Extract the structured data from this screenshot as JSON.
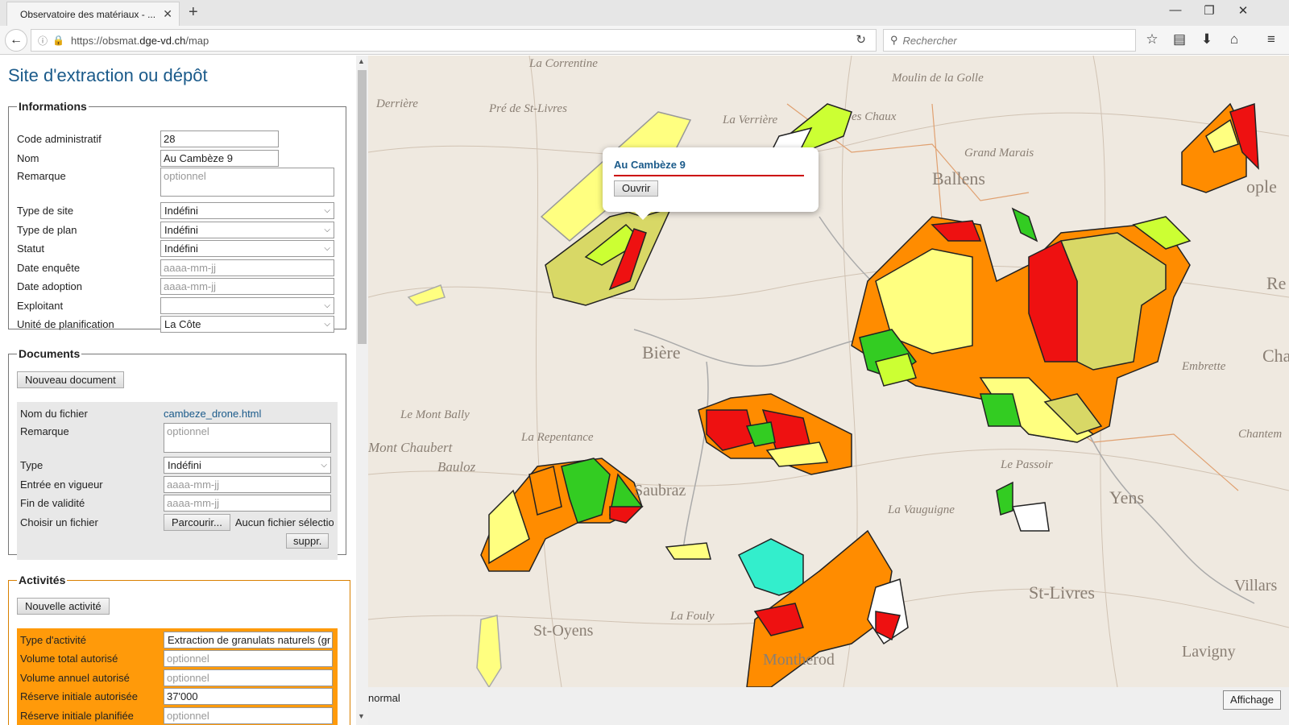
{
  "browser": {
    "tab_title": "Observatoire des matériaux - ...",
    "url_prefix": "https://obsmat.",
    "url_host": "dge-vd.ch",
    "url_path": "/map",
    "search_placeholder": "Rechercher"
  },
  "panel": {
    "title": "Site d'extraction ou dépôt",
    "informations": {
      "legend": "Informations",
      "code_label": "Code administratif",
      "code_value": "28",
      "nom_label": "Nom",
      "nom_value": "Au Cambèze 9",
      "remarque_label": "Remarque",
      "remarque_placeholder": "optionnel",
      "type_site_label": "Type de site",
      "type_site_value": "Indéfini",
      "type_plan_label": "Type de plan",
      "type_plan_value": "Indéfini",
      "statut_label": "Statut",
      "statut_value": "Indéfini",
      "date_enquete_label": "Date enquête",
      "date_enquete_placeholder": "aaaa-mm-jj",
      "date_adoption_label": "Date adoption",
      "date_adoption_placeholder": "aaaa-mm-jj",
      "exploitant_label": "Exploitant",
      "exploitant_value": "",
      "unite_label": "Unité de planification",
      "unite_value": "La Côte"
    },
    "documents": {
      "legend": "Documents",
      "new_button": "Nouveau document",
      "fichier_label": "Nom du fichier",
      "fichier_value": "cambeze_drone.html",
      "remarque_label": "Remarque",
      "remarque_placeholder": "optionnel",
      "type_label": "Type",
      "type_value": "Indéfini",
      "entree_label": "Entrée en vigueur",
      "entree_placeholder": "aaaa-mm-jj",
      "fin_label": "Fin de validité",
      "fin_placeholder": "aaaa-mm-jj",
      "choisir_label": "Choisir un fichier",
      "parcourir": "Parcourir...",
      "aucun": "Aucun fichier sélection",
      "suppr": "suppr."
    },
    "activites": {
      "legend": "Activités",
      "new_button": "Nouvelle activité",
      "type_label": "Type d'activité",
      "type_value": "Extraction de granulats naturels (gr",
      "vol_total_label": "Volume total autorisé",
      "vol_total_placeholder": "optionnel",
      "vol_annuel_label": "Volume annuel autorisé",
      "vol_annuel_placeholder": "optionnel",
      "reserve_label": "Réserve initiale autorisée",
      "reserve_value": "37'000",
      "reserve_plan_label": "Réserve initiale planifiée",
      "reserve_plan_placeholder": "optionnel"
    }
  },
  "map": {
    "popup_title": "Au Cambèze 9",
    "popup_button": "Ouvrir",
    "mode_label": "normal",
    "affichage_button": "Affichage",
    "place_names": [
      "La Correntine",
      "Moulin de la Golle",
      "Derrière",
      "Pré de St-Livres",
      "La Verrière",
      "es Chaux",
      "Grand Marais",
      "Ballens",
      "Bière",
      "Le Mont Bally",
      "La Repentance",
      "Mont Chaubert",
      "Bauloz",
      "Saubraz",
      "Le Passoir",
      "La Vauguigne",
      "Yens",
      "St-Livres",
      "St-Oyens",
      "La Fouly",
      "Montherod",
      "Lavigny",
      "Villars",
      "Chantem",
      "Embrette",
      "Cha",
      "Re",
      "ople"
    ],
    "colors": {
      "orange": "#ff8c00",
      "red": "#ee1111",
      "yellow": "#ffff80",
      "lightgreen": "#ccff33",
      "green": "#33cc22",
      "olive": "#d8d866",
      "cyan": "#33eecc"
    }
  }
}
